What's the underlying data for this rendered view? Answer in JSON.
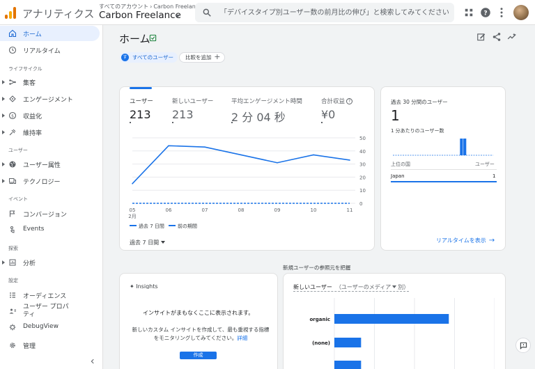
{
  "topbar": {
    "app_title": "アナリティクス",
    "breadcrumb_all_accounts": "すべてのアカウント",
    "breadcrumb_account": "Carbon Freelance",
    "property_name": "Carbon Freelance",
    "search_placeholder": "「デバイスタイプ別ユーザー数の前月比の伸び」と検索してみてください",
    "icons": [
      "apps-icon",
      "help-icon",
      "more-vert-icon",
      "avatar"
    ]
  },
  "sidebar": {
    "items": [
      {
        "label": "ホーム",
        "icon": "home-icon",
        "active": true
      },
      {
        "label": "リアルタイム",
        "icon": "clock-icon"
      }
    ],
    "sections": {
      "lifecycle": "ライフサイクル",
      "user": "ユーザー",
      "event": "イベント",
      "explore": "探索",
      "configure": "設定"
    },
    "lifecycle_items": [
      {
        "label": "集客",
        "icon": "acquisition-icon"
      },
      {
        "label": "エンゲージメント",
        "icon": "engagement-icon"
      },
      {
        "label": "収益化",
        "icon": "dollar-icon"
      },
      {
        "label": "維持率",
        "icon": "retention-icon"
      }
    ],
    "user_items": [
      {
        "label": "ユーザー属性",
        "icon": "globe-icon"
      },
      {
        "label": "テクノロジー",
        "icon": "devices-icon"
      }
    ],
    "event_items": [
      {
        "label": "コンバージョン",
        "icon": "flag-icon"
      },
      {
        "label": "Events",
        "icon": "touch-icon"
      }
    ],
    "explore_items": [
      {
        "label": "分析",
        "icon": "analysis-icon"
      }
    ],
    "configure_items": [
      {
        "label": "オーディエンス",
        "icon": "audience-icon"
      },
      {
        "label": "ユーザー プロパティ",
        "icon": "user-property-icon"
      },
      {
        "label": "DebugView",
        "icon": "debug-icon"
      }
    ],
    "admin_label": "管理"
  },
  "main": {
    "title": "ホーム",
    "chip_all_users": "すべてのユーザー",
    "chip_compare": "比較を追加",
    "metrics": [
      {
        "label": "ユーザー",
        "value": "213"
      },
      {
        "label": "新しいユーザー",
        "value": "213"
      },
      {
        "label": "平均エンゲージメント時間",
        "value": "2 分 04 秒"
      },
      {
        "label": "合計収益",
        "value": "¥0"
      }
    ],
    "legend_current": "過去 7 日間",
    "legend_previous": "前の期間",
    "date_range": "過去 7 日間"
  },
  "chart_data": {
    "type": "line",
    "x": [
      "05",
      "06",
      "07",
      "08",
      "09",
      "10",
      "11"
    ],
    "x_month": "2月",
    "series": [
      {
        "name": "過去 7 日間",
        "values": [
          15,
          44,
          43,
          37,
          31,
          37,
          33
        ]
      },
      {
        "name": "前の期間",
        "values": [
          0,
          0,
          0,
          0,
          0,
          0,
          0
        ]
      }
    ],
    "yticks": [
      "0",
      "10",
      "20",
      "30",
      "40",
      "50"
    ],
    "ylim": [
      0,
      50
    ],
    "colors": {
      "current": "#1a73e8",
      "previous": "#1a73e8"
    }
  },
  "realtime": {
    "label": "過去 30 分間のユーザー",
    "value": "1",
    "per_minute_label": "1 分あたりのユーザー数",
    "per_minute": [
      0,
      0,
      0,
      0,
      0,
      0,
      0,
      0,
      0,
      0,
      0,
      0,
      0,
      0,
      0,
      0,
      0,
      0,
      0,
      0,
      1,
      1,
      0,
      0,
      0,
      0,
      0,
      0,
      0,
      0
    ],
    "col_country": "上位の国",
    "col_users": "ユーザー",
    "rows": [
      {
        "country": "Japan",
        "users": "1"
      }
    ],
    "link": "リアルタイムを表示"
  },
  "section_heading": "新規ユーザーの参照元を把握",
  "insights": {
    "title": "Insights",
    "msg1": "インサイトがまもなくここに表示されます。",
    "msg2": "新しいカスタム インサイトを作成して、最も重視する指標をモニタリングしてみてください。",
    "msg2_link": "詳細",
    "create_label": "作成"
  },
  "acquisition": {
    "title": "新しいユーザー",
    "dimension": "（ユーザーのメディア",
    "dimension_suffix": "別）",
    "bars": [
      {
        "label": "organic",
        "value": 150
      },
      {
        "label": "(none)",
        "value": 35
      },
      {
        "label": "",
        "value": 35
      }
    ],
    "xlim": [
      0,
      210
    ]
  }
}
